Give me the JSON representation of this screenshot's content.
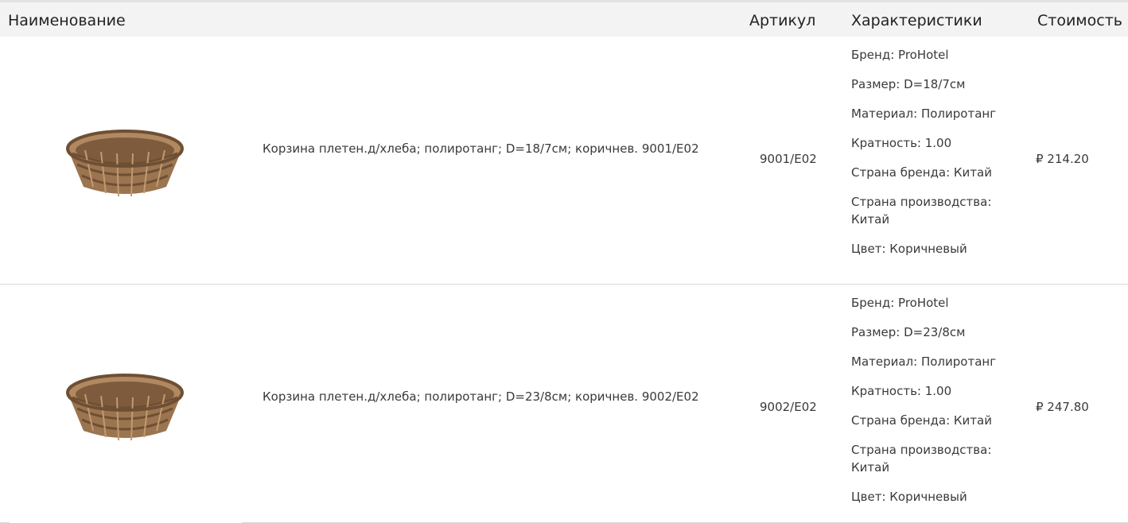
{
  "header": {
    "name": "Наименование",
    "sku": "Артикул",
    "chars": "Характеристики",
    "price": "Стоимость"
  },
  "rows": [
    {
      "image_icon": "basket-icon",
      "name": "Корзина плетен.д/хлеба; полиротанг; D=18/7см; коричнев. 9001/E02",
      "sku": "9001/E02",
      "chars": [
        "Бренд: ProHotel",
        "Размер: D=18/7см",
        "Материал: Полиротанг",
        "Кратность: 1.00",
        "Страна бренда: Китай",
        "Страна производства: Китай",
        "Цвет: Коричневый"
      ],
      "price": "₽ 214.20"
    },
    {
      "image_icon": "basket-icon",
      "name": "Корзина плетен.д/хлеба; полиротанг; D=23/8см; коричнев. 9002/E02",
      "sku": "9002/E02",
      "chars": [
        "Бренд: ProHotel",
        "Размер: D=23/8см",
        "Материал: Полиротанг",
        "Кратность: 1.00",
        "Страна бренда: Китай",
        "Страна производства: Китай",
        "Цвет: Коричневый"
      ],
      "price": "₽ 247.80"
    }
  ],
  "colors": {
    "header_bg": "#f3f3f3",
    "basket": "#9b7450",
    "basket_dark": "#6f4f33",
    "divider": "#d9d9d9"
  }
}
